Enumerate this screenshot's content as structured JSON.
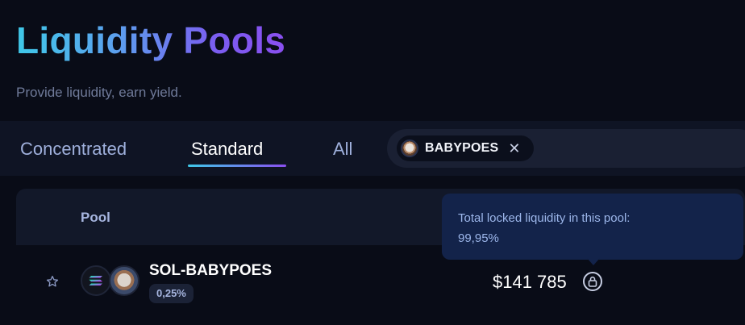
{
  "header": {
    "title": "Liquidity Pools",
    "subtitle": "Provide liquidity, earn yield."
  },
  "tabs": [
    {
      "label": "Concentrated",
      "active": false
    },
    {
      "label": "Standard",
      "active": true
    },
    {
      "label": "All",
      "active": false
    }
  ],
  "search": {
    "chip_label": "BABYPOES",
    "chip_close": "✕"
  },
  "table": {
    "columns": {
      "pool": "Pool"
    },
    "rows": [
      {
        "pair": "SOL-BABYPOES",
        "fee": "0,25%",
        "tvl": "$141 785",
        "tokens": [
          "SOL",
          "BABYPOES"
        ]
      }
    ]
  },
  "tooltip": {
    "line1": "Total locked liquidity in this pool:",
    "line2": "99,95%"
  },
  "icons": {
    "star": "star-icon",
    "lock": "lock-icon",
    "close": "close-icon"
  },
  "colors": {
    "background": "#090c17",
    "title_gradient_start": "#3fc8e8",
    "title_gradient_end": "#8a4ff0",
    "tooltip_bg": "#13234a"
  }
}
